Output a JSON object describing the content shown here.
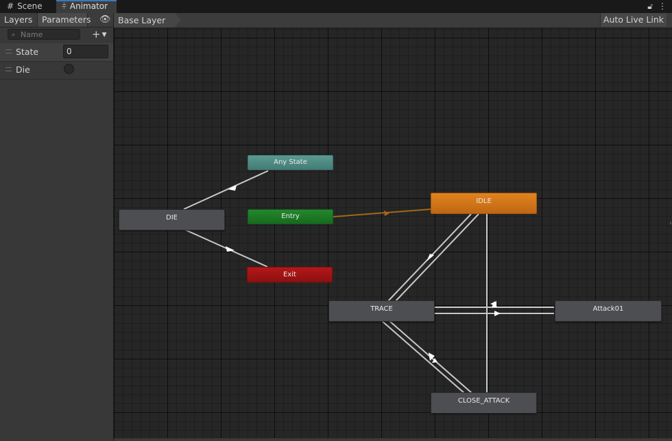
{
  "tabs": {
    "scene_label": "Scene",
    "animator_label": "Animator"
  },
  "left_panel": {
    "tab_layers": "Layers",
    "tab_parameters": "Parameters",
    "search_placeholder": "Name",
    "parameters": [
      {
        "name": "State",
        "type": "int",
        "value": "0"
      },
      {
        "name": "Die",
        "type": "bool",
        "value": false
      }
    ]
  },
  "breadcrumb": {
    "layer": "Base Layer",
    "auto_live_link": "Auto Live Link"
  },
  "graph": {
    "nodes": {
      "any_state": "Any State",
      "entry": "Entry",
      "exit": "Exit",
      "die": "DIE",
      "idle": "IDLE",
      "trace": "TRACE",
      "attack01": "Attack01",
      "close_attack": "CLOSE_ATTACK"
    },
    "colors": {
      "any_state": "#4e8c84",
      "entry": "#1d7a26",
      "exit": "#a01414",
      "idle": "#d07418",
      "state": "#4d4e51",
      "transition": "#c8c8c8",
      "default_transition": "#a06a14",
      "tab_accent": "#3a79bb"
    }
  }
}
